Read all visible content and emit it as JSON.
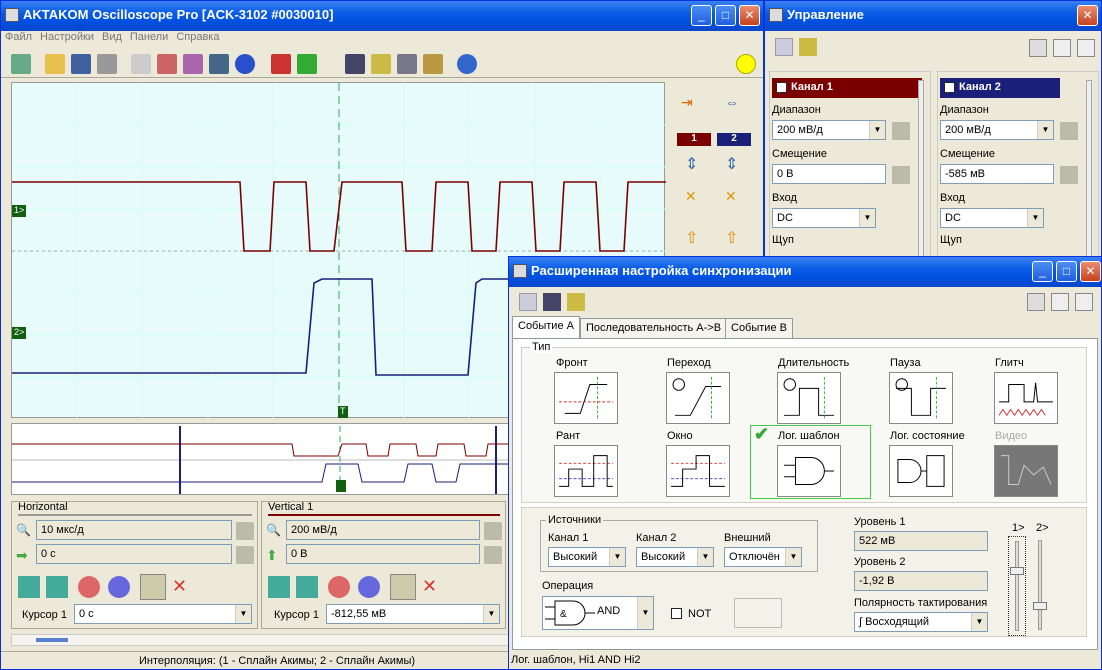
{
  "main_window": {
    "title": "AKTAKOM Oscilloscope Pro [ACK-3102 #0030010]",
    "menu": [
      "Файл",
      "Настройки",
      "Вид",
      "Панели",
      "Справка"
    ],
    "ch1_tag": "1",
    "ch2_tag": "2",
    "ch1_marker": "1>",
    "ch2_marker": "2>",
    "trig_marker": "T"
  },
  "horizontal": {
    "title": "Horizontal",
    "timebase": "10 мкс/д",
    "offset": "0 с",
    "cursor_label": "Курсор 1",
    "cursor_value": "0 с"
  },
  "vertical": {
    "title": "Vertical 1",
    "range": "200 мВ/д",
    "offset": "0 В",
    "cursor_label": "Курсор 1",
    "cursor_value": "-812,55 мВ"
  },
  "status_left": "Интерполяция: (1 - Сплайн Акимы; 2 - Сплайн Акимы)",
  "control": {
    "title": "Управление",
    "ch1": {
      "name": "Канал 1",
      "range_label": "Диапазон",
      "range": "200 мВ/д",
      "offset_label": "Смещение",
      "offset": "0 В",
      "input_label": "Вход",
      "input": "DC",
      "probe_label": "Щуп"
    },
    "ch2": {
      "name": "Канал 2",
      "range_label": "Диапазон",
      "range": "200 мВ/д",
      "offset_label": "Смещение",
      "offset": "-585 мВ",
      "input_label": "Вход",
      "input": "DC",
      "probe_label": "Щуп"
    }
  },
  "sync": {
    "title": "Расширенная настройка синхронизации",
    "tabs": [
      "Событие A",
      "Последовательность A->B",
      "Событие B"
    ],
    "type_group": "Тип",
    "types": [
      "Фронт",
      "Переход",
      "Длительность",
      "Пауза",
      "Глитч",
      "Рант",
      "Окно",
      "Лог. шаблон",
      "Лог. состояние",
      "Видео"
    ],
    "sources_group": "Источники",
    "src_ch1_label": "Канал 1",
    "src_ch1": "Высокий",
    "src_ch2_label": "Канал 2",
    "src_ch2": "Высокий",
    "src_ext_label": "Внешний",
    "src_ext": "Отключён",
    "operation_label": "Операция",
    "operation": "AND",
    "not_label": "NOT",
    "level1_label": "Уровень 1",
    "level1": "522 мВ",
    "level2_label": "Уровень 2",
    "level2": "-1,92 В",
    "polarity_label": "Полярность тактирования",
    "polarity": "Восходящий",
    "slider1": "1>",
    "slider2": "2>",
    "status": "Лог. шаблон, Hi1 AND Hi2"
  }
}
